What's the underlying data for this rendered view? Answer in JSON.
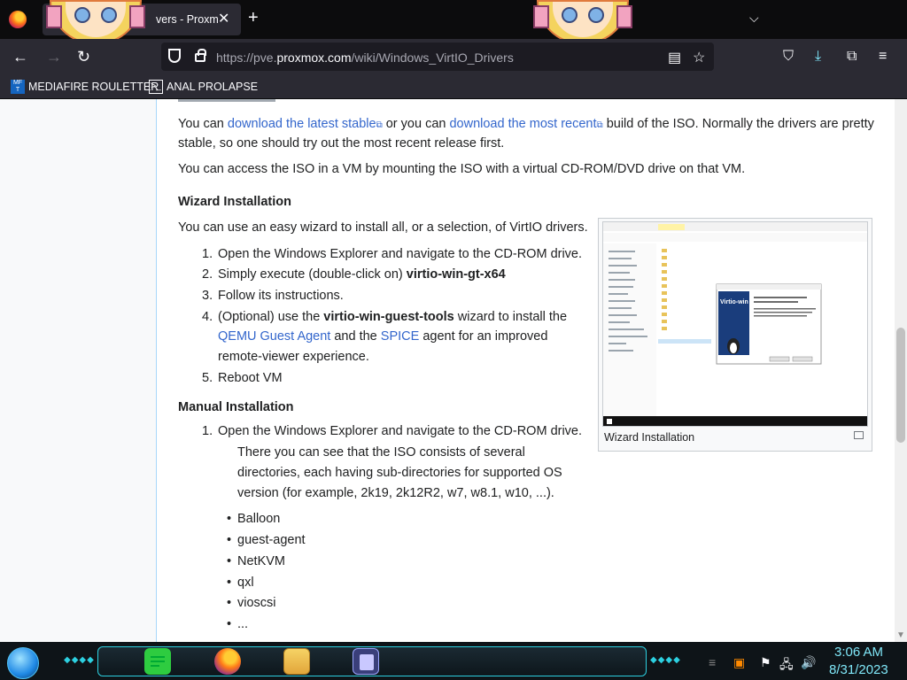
{
  "browser": {
    "tab_title": "vers - Proxm",
    "url_prefix": "https://pve.",
    "url_domain": "proxmox.com",
    "url_path": "/wiki/Windows_VirtIO_Drivers",
    "bookmarks": [
      {
        "label": "MEDIAFIRE ROULETTER",
        "icon_text": "MF T"
      },
      {
        "label": "ANAL PROLAPSE"
      }
    ]
  },
  "article": {
    "p1_a": "You can ",
    "p1_link1": "download the latest stable",
    "p1_b": " or you can ",
    "p1_link2": "download the most recent",
    "p1_c": " build of the ISO. Normally the drivers are pretty",
    "p1_line2": "stable, so one should try out the most recent release first.",
    "p2": "You can access the ISO in a VM by mounting the ISO with a virtual CD-ROM/DVD drive on that VM.",
    "wizard_heading": "Wizard Installation",
    "wizard_intro": "You can use an easy wizard to install all, or a selection, of VirtIO drivers.",
    "wizard_steps": {
      "s1": "Open the Windows Explorer and navigate to the CD-ROM drive.",
      "s2_a": "Simply execute (double-click on) ",
      "s2_b": "virtio-win-gt-x64",
      "s3": "Follow its instructions.",
      "s4_a": "(Optional) use the ",
      "s4_b": "virtio-win-guest-tools",
      "s4_c": " wizard to install the",
      "s4_link1": "QEMU Guest Agent",
      "s4_d": " and the ",
      "s4_link2": "SPICE",
      "s4_e": " agent for an improved",
      "s4_line3": "remote-viewer experience.",
      "s5": "Reboot VM"
    },
    "manual_heading": "Manual Installation",
    "manual_step1": "Open the Windows Explorer and navigate to the CD-ROM drive.",
    "manual_desc": [
      "There you can see that the ISO consists of several",
      "directories, each having sub-directories for supported OS",
      "version (for example, 2k19, 2k12R2, w7, w8.1, w10, ...)."
    ],
    "dirs": [
      "Balloon",
      "guest-agent",
      "NetKVM",
      "qxl",
      "vioscsi",
      "..."
    ],
    "thumb_caption": "Wizard Installation",
    "thumb_product": "Virtio-win"
  },
  "taskbar": {
    "time": "3:06 AM",
    "date": "8/31/2023"
  }
}
